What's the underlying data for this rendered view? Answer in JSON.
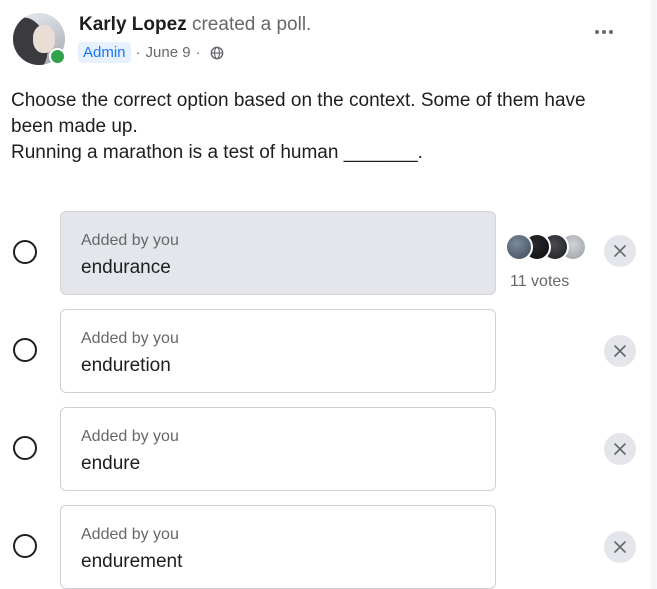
{
  "post": {
    "author": "Karly Lopez",
    "action": "created a poll.",
    "badge": "Admin",
    "date": "June 9",
    "separator": "·",
    "privacy_icon": "globe-icon",
    "more_icon": "more-horizontal-icon",
    "online_status_color": "#31a24c"
  },
  "question": {
    "line1": "Choose the correct option based on the context. Some of them have",
    "line2": "been made up.",
    "line3": "Running a marathon is a test of human _______."
  },
  "options": [
    {
      "meta": "Added by you",
      "text": "endurance",
      "selected": true,
      "votes_label": "11 votes",
      "remove_icon": "close-icon"
    },
    {
      "meta": "Added by you",
      "text": "enduretion",
      "selected": false,
      "remove_icon": "close-icon"
    },
    {
      "meta": "Added by you",
      "text": "endure",
      "selected": false,
      "remove_icon": "close-icon"
    },
    {
      "meta": "Added by you",
      "text": "endurement",
      "selected": false,
      "remove_icon": "close-icon"
    }
  ],
  "colors": {
    "admin_badge_text": "#1877f2",
    "selected_option_bg": "#e4e6eb",
    "secondary_text": "#65676b"
  }
}
